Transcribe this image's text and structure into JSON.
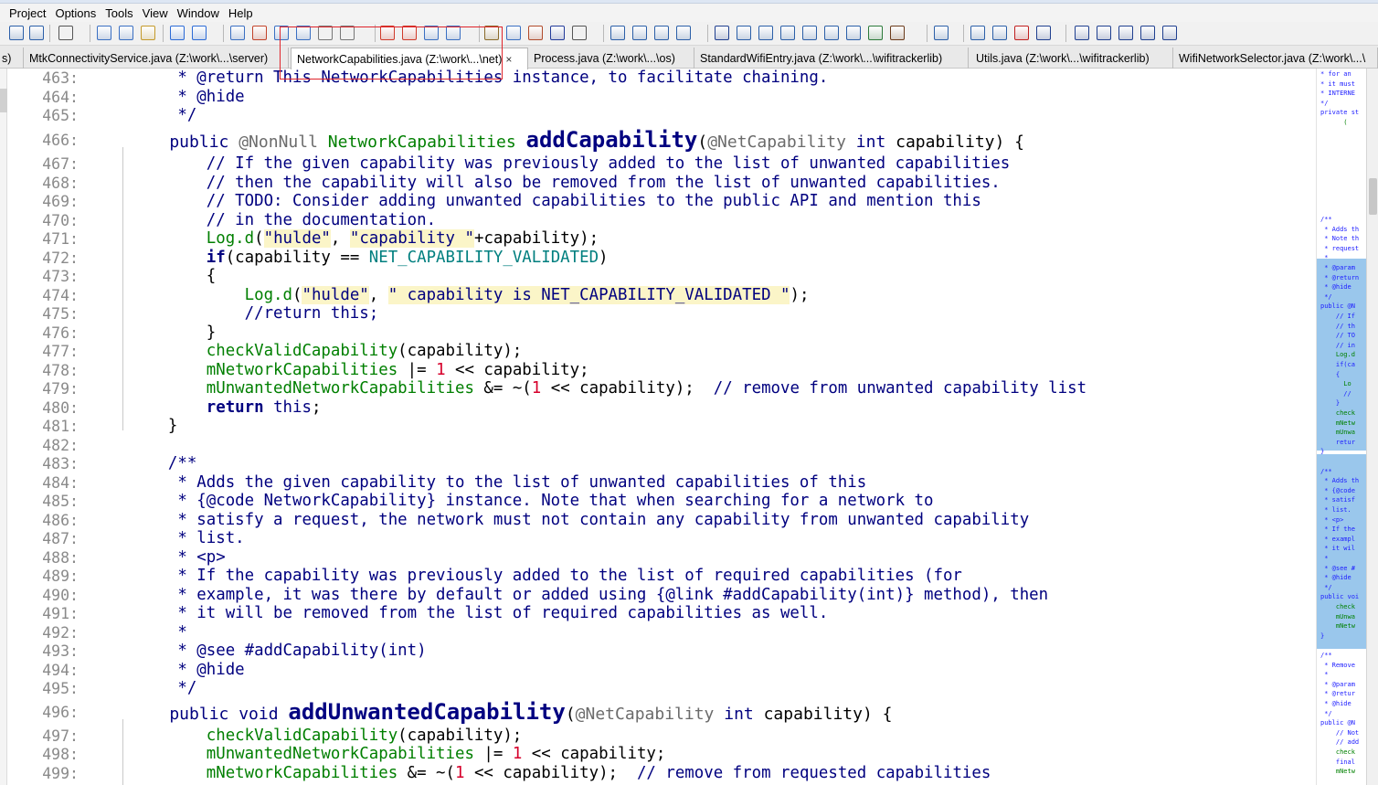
{
  "menu": [
    "Project",
    "Options",
    "Tools",
    "View",
    "Window",
    "Help"
  ],
  "toolbar_icons": [
    "save-icon",
    "save-all-icon",
    "print-icon",
    "cut-icon",
    "copy-icon",
    "paste-icon",
    "undo-icon",
    "redo-icon",
    "find-icon",
    "goto-icon",
    "find-file-icon",
    "replace-icon",
    "xy-icon",
    "www-icon",
    "bookmark-icon",
    "bookmark-prev-icon",
    "bookmark-next-icon",
    "jump-icon",
    "book-icon",
    "book-open-icon",
    "project-icon",
    "symbol-icon",
    "window-icon",
    "tile-icon",
    "cascade-icon",
    "overlap-icon",
    "p-icon",
    "relation-icon",
    "outline-icon",
    "s-icon",
    "map-icon",
    "info-icon",
    "browse-icon",
    "context-icon",
    "filter-icon",
    "sync-icon",
    "zoom-in-icon",
    "expand-icon",
    "collapse-icon",
    "close-icon",
    "a-icon",
    "b-icon",
    "c-icon",
    "d-icon",
    "e-icon",
    "f-icon"
  ],
  "tabs": [
    {
      "label": "s)",
      "active": false
    },
    {
      "label": "MtkConnectivityService.java (Z:\\work\\...\\server)",
      "active": false
    },
    {
      "label": "NetworkCapabilities.java (Z:\\work\\...\\net)",
      "active": true,
      "close": "×"
    },
    {
      "label": "Process.java (Z:\\work\\...\\os)",
      "active": false
    },
    {
      "label": "StandardWifiEntry.java (Z:\\work\\...\\wifitrackerlib)",
      "active": false
    },
    {
      "label": "Utils.java (Z:\\work\\...\\wifitrackerlib)",
      "active": false
    },
    {
      "label": "WifiNetworkSelector.java (Z:\\work\\...\\",
      "active": false
    }
  ],
  "lines": [
    {
      "num": "463:",
      "segs": [
        [
          "jd",
          "     * @return This NetworkCapabilities instance, to facilitate chaining."
        ]
      ]
    },
    {
      "num": "464:",
      "segs": [
        [
          "jd",
          "     * @hide"
        ]
      ]
    },
    {
      "num": "465:",
      "segs": [
        [
          "jd",
          "     */"
        ]
      ]
    },
    {
      "num": "466:",
      "big": true,
      "segs": [
        [
          "kwn",
          "    public "
        ],
        [
          "an",
          "@NonNull "
        ],
        [
          "ty",
          "NetworkCapabilities "
        ],
        [
          "fn",
          "addCapability"
        ],
        [
          "op",
          "("
        ],
        [
          "an",
          "@NetCapability "
        ],
        [
          "kwn",
          "int "
        ],
        [
          "op",
          "capability) {"
        ]
      ]
    },
    {
      "num": "467:",
      "segs": [
        [
          "cm",
          "        // If the given capability was previously added to the list of unwanted capabilities"
        ]
      ]
    },
    {
      "num": "468:",
      "segs": [
        [
          "cm",
          "        // then the capability will also be removed from the list of unwanted capabilities."
        ]
      ]
    },
    {
      "num": "469:",
      "segs": [
        [
          "cm",
          "        // TODO: Consider adding unwanted capabilities to the public API and mention this"
        ]
      ]
    },
    {
      "num": "470:",
      "segs": [
        [
          "cm",
          "        // in the documentation."
        ]
      ]
    },
    {
      "num": "471:",
      "segs": [
        [
          "mth",
          "        Log.d"
        ],
        [
          "op",
          "("
        ],
        [
          "st",
          "\"hulde\""
        ],
        [
          "op",
          ", "
        ],
        [
          "st",
          "\"capability \""
        ],
        [
          "op",
          "+capability);"
        ]
      ]
    },
    {
      "num": "472:",
      "segs": [
        [
          "kw",
          "        if"
        ],
        [
          "op",
          "(capability == "
        ],
        [
          "cs",
          "NET_CAPABILITY_VALIDATED"
        ],
        [
          "op",
          ")"
        ]
      ]
    },
    {
      "num": "473:",
      "segs": [
        [
          "op",
          "        {"
        ]
      ]
    },
    {
      "num": "474:",
      "segs": [
        [
          "mth",
          "            Log.d"
        ],
        [
          "op",
          "("
        ],
        [
          "st",
          "\"hulde\""
        ],
        [
          "op",
          ", "
        ],
        [
          "st",
          "\" capability is NET_CAPABILITY_VALIDATED \""
        ],
        [
          "op",
          ");"
        ]
      ]
    },
    {
      "num": "475:",
      "segs": [
        [
          "cm",
          "            //return this;"
        ]
      ]
    },
    {
      "num": "476:",
      "segs": [
        [
          "op",
          "        }"
        ]
      ]
    },
    {
      "num": "477:",
      "segs": [
        [
          "mth",
          "        checkValidCapability"
        ],
        [
          "op",
          "(capability);"
        ]
      ]
    },
    {
      "num": "478:",
      "segs": [
        [
          "fld",
          "        mNetworkCapabilities "
        ],
        [
          "op",
          "|= "
        ],
        [
          "nm",
          "1"
        ],
        [
          "op",
          " << capability;"
        ]
      ]
    },
    {
      "num": "479:",
      "segs": [
        [
          "fld",
          "        mUnwantedNetworkCapabilities "
        ],
        [
          "op",
          "&= ~("
        ],
        [
          "nm",
          "1"
        ],
        [
          "op",
          " << capability);  "
        ],
        [
          "cm",
          "// remove from unwanted capability list"
        ]
      ]
    },
    {
      "num": "480:",
      "segs": [
        [
          "kw",
          "        return "
        ],
        [
          "kwn",
          "this"
        ],
        [
          "op",
          ";"
        ]
      ]
    },
    {
      "num": "481:",
      "segs": [
        [
          "op",
          "    }"
        ]
      ]
    },
    {
      "num": "482:",
      "segs": []
    },
    {
      "num": "483:",
      "segs": [
        [
          "jd",
          "    /**"
        ]
      ]
    },
    {
      "num": "484:",
      "segs": [
        [
          "jd",
          "     * Adds the given capability to the list of unwanted capabilities of this"
        ]
      ]
    },
    {
      "num": "485:",
      "segs": [
        [
          "jd",
          "     * {@code NetworkCapability} instance. Note that when searching for a network to"
        ]
      ]
    },
    {
      "num": "486:",
      "segs": [
        [
          "jd",
          "     * satisfy a request, the network must not contain any capability from unwanted capability"
        ]
      ]
    },
    {
      "num": "487:",
      "segs": [
        [
          "jd",
          "     * list."
        ]
      ]
    },
    {
      "num": "488:",
      "segs": [
        [
          "jd",
          "     * <p>"
        ]
      ]
    },
    {
      "num": "489:",
      "segs": [
        [
          "jd",
          "     * If the capability was previously added to the list of required capabilities (for"
        ]
      ]
    },
    {
      "num": "490:",
      "segs": [
        [
          "jd",
          "     * example, it was there by default or added using {@link #addCapability(int)} method), then"
        ]
      ]
    },
    {
      "num": "491:",
      "segs": [
        [
          "jd",
          "     * it will be removed from the list of required capabilities as well."
        ]
      ]
    },
    {
      "num": "492:",
      "segs": [
        [
          "jd",
          "     *"
        ]
      ]
    },
    {
      "num": "493:",
      "segs": [
        [
          "jd",
          "     * @see #addCapability(int)"
        ]
      ]
    },
    {
      "num": "494:",
      "segs": [
        [
          "jd",
          "     * @hide"
        ]
      ]
    },
    {
      "num": "495:",
      "segs": [
        [
          "jd",
          "     */"
        ]
      ]
    },
    {
      "num": "496:",
      "big": true,
      "segs": [
        [
          "kwn",
          "    public void "
        ],
        [
          "fn",
          "addUnwantedCapability"
        ],
        [
          "op",
          "("
        ],
        [
          "an",
          "@NetCapability "
        ],
        [
          "kwn",
          "int "
        ],
        [
          "op",
          "capability) {"
        ]
      ]
    },
    {
      "num": "497:",
      "segs": [
        [
          "mth",
          "        checkValidCapability"
        ],
        [
          "op",
          "(capability);"
        ]
      ]
    },
    {
      "num": "498:",
      "segs": [
        [
          "fld",
          "        mUnwantedNetworkCapabilities "
        ],
        [
          "op",
          "|= "
        ],
        [
          "nm",
          "1"
        ],
        [
          "op",
          " << capability;"
        ]
      ]
    },
    {
      "num": "499:",
      "segs": [
        [
          "fld",
          "        mNetworkCapabilities "
        ],
        [
          "op",
          "&= ~("
        ],
        [
          "nm",
          "1"
        ],
        [
          "op",
          " << capability);  "
        ],
        [
          "cm",
          "// remove from requested capabilities"
        ]
      ]
    }
  ],
  "minimap": [
    [
      "* for an",
      "b"
    ],
    [
      "* it must",
      "b"
    ],
    [
      "* INTERNE",
      "b"
    ],
    [
      "*/",
      "b"
    ],
    [
      "private st",
      "b"
    ],
    [
      "      (",
      "g"
    ],
    [
      "      ",
      "b"
    ],
    [
      "",
      "b"
    ],
    [
      "",
      "b"
    ],
    [
      "",
      "b"
    ],
    [
      "",
      "b"
    ],
    [
      "",
      "b"
    ],
    [
      "",
      "b"
    ],
    [
      "",
      "b"
    ],
    [
      "",
      "b"
    ],
    [
      "/**",
      "b"
    ],
    [
      " * Adds th",
      "b"
    ],
    [
      " * Note th",
      "b"
    ],
    [
      " * request",
      "b"
    ],
    [
      " *",
      "b"
    ],
    [
      " * @param",
      "b"
    ],
    [
      " * @return",
      "b"
    ],
    [
      " * @hide",
      "b"
    ],
    [
      " */",
      "b"
    ],
    [
      "public @N",
      "b"
    ],
    [
      "    // If",
      "b"
    ],
    [
      "    // th",
      "b"
    ],
    [
      "    // TO",
      "b"
    ],
    [
      "    // in",
      "b"
    ],
    [
      "    Log.d",
      "g"
    ],
    [
      "    if(ca",
      "b"
    ],
    [
      "    {",
      "b"
    ],
    [
      "      Lo",
      "g"
    ],
    [
      "      //",
      "b"
    ],
    [
      "    }",
      "b"
    ],
    [
      "    check",
      "g"
    ],
    [
      "    mNetw",
      "g"
    ],
    [
      "    mUnwa",
      "g"
    ],
    [
      "    retur",
      "b"
    ],
    [
      "}",
      "b"
    ],
    [
      "",
      "b"
    ],
    [
      "/**",
      "b"
    ],
    [
      " * Adds th",
      "b"
    ],
    [
      " * {@code",
      "b"
    ],
    [
      " * satisf",
      "b"
    ],
    [
      " * list.",
      "b"
    ],
    [
      " * <p>",
      "b"
    ],
    [
      " * If the",
      "b"
    ],
    [
      " * exampl",
      "b"
    ],
    [
      " * it wil",
      "b"
    ],
    [
      " *",
      "b"
    ],
    [
      " * @see #",
      "b"
    ],
    [
      " * @hide",
      "b"
    ],
    [
      " */",
      "b"
    ],
    [
      "public voi",
      "b"
    ],
    [
      "    check",
      "g"
    ],
    [
      "    mUnwa",
      "g"
    ],
    [
      "    mNetw",
      "g"
    ],
    [
      "}",
      "b"
    ],
    [
      "",
      "b"
    ],
    [
      "/**",
      "b"
    ],
    [
      " * Remove",
      "b"
    ],
    [
      " *",
      "b"
    ],
    [
      " * @param",
      "b"
    ],
    [
      " * @retur",
      "b"
    ],
    [
      " * @hide",
      "b"
    ],
    [
      " */",
      "b"
    ],
    [
      "public @N",
      "b"
    ],
    [
      "    // Not",
      "b"
    ],
    [
      "    // add",
      "b"
    ],
    [
      "    check",
      "g"
    ],
    [
      "    final",
      "b"
    ],
    [
      "    mNetw",
      "g"
    ]
  ]
}
